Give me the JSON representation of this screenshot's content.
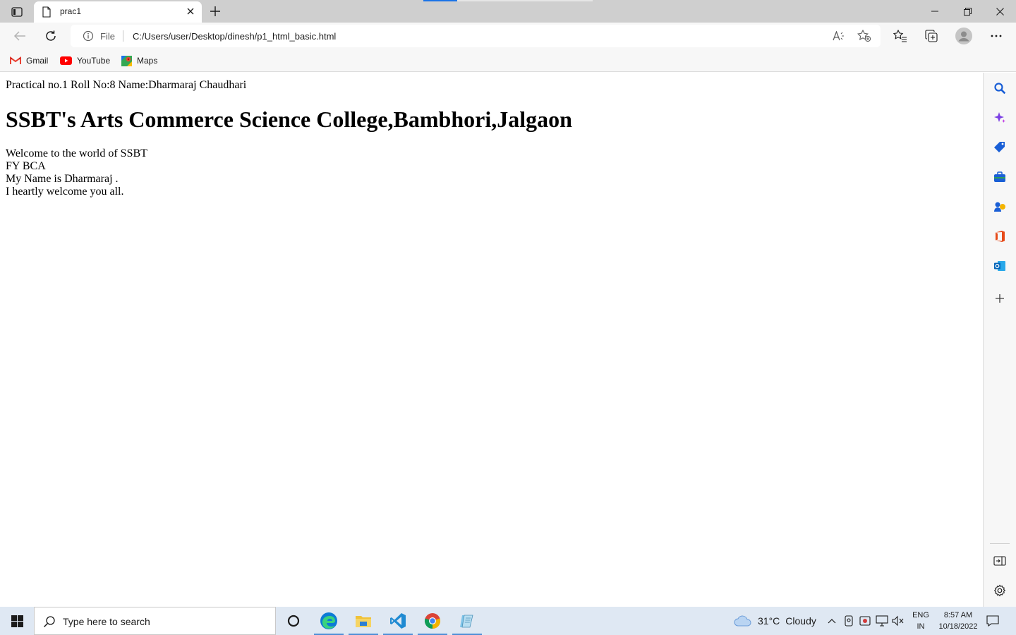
{
  "browser": {
    "tab": {
      "title": "prac1"
    },
    "load_progress": 0.2,
    "address": {
      "scheme_label": "File",
      "url": "C:/Users/user/Desktop/dinesh/p1_html_basic.html"
    },
    "favorites": [
      {
        "label": "Gmail",
        "icon": "gmail-icon"
      },
      {
        "label": "YouTube",
        "icon": "youtube-icon"
      },
      {
        "label": "Maps",
        "icon": "maps-icon"
      }
    ],
    "sidebar_icons": [
      "search-icon",
      "copilot-icon",
      "shopping-icon",
      "tools-icon",
      "games-icon",
      "office-icon",
      "outlook-icon",
      "add-icon",
      "split-screen-icon",
      "settings-icon"
    ]
  },
  "page": {
    "header_line": "Practical no.1 Roll No:8 Name:Dharmaraj Chaudhari",
    "heading": "SSBT's Arts Commerce Science College,Bambhori,Jalgaon",
    "lines": [
      "Welcome to the world of SSBT",
      "FY BCA",
      "My Name is Dharmaraj .",
      "I heartly welcome you all."
    ]
  },
  "taskbar": {
    "search_placeholder": "Type here to search",
    "weather": {
      "temp": "31°C",
      "condition": "Cloudy"
    },
    "lang": {
      "line1": "ENG",
      "line2": "IN"
    },
    "clock": {
      "time": "8:57 AM",
      "date": "10/18/2022"
    },
    "apps": [
      "cortana-icon",
      "edge-icon",
      "file-explorer-icon",
      "vscode-icon",
      "chrome-icon",
      "notepad-icon"
    ]
  },
  "colors": {
    "accent": "#1a73e8",
    "taskbar_bg": "#dfe8f3",
    "tab_strip_bg": "#cfcfcf"
  }
}
